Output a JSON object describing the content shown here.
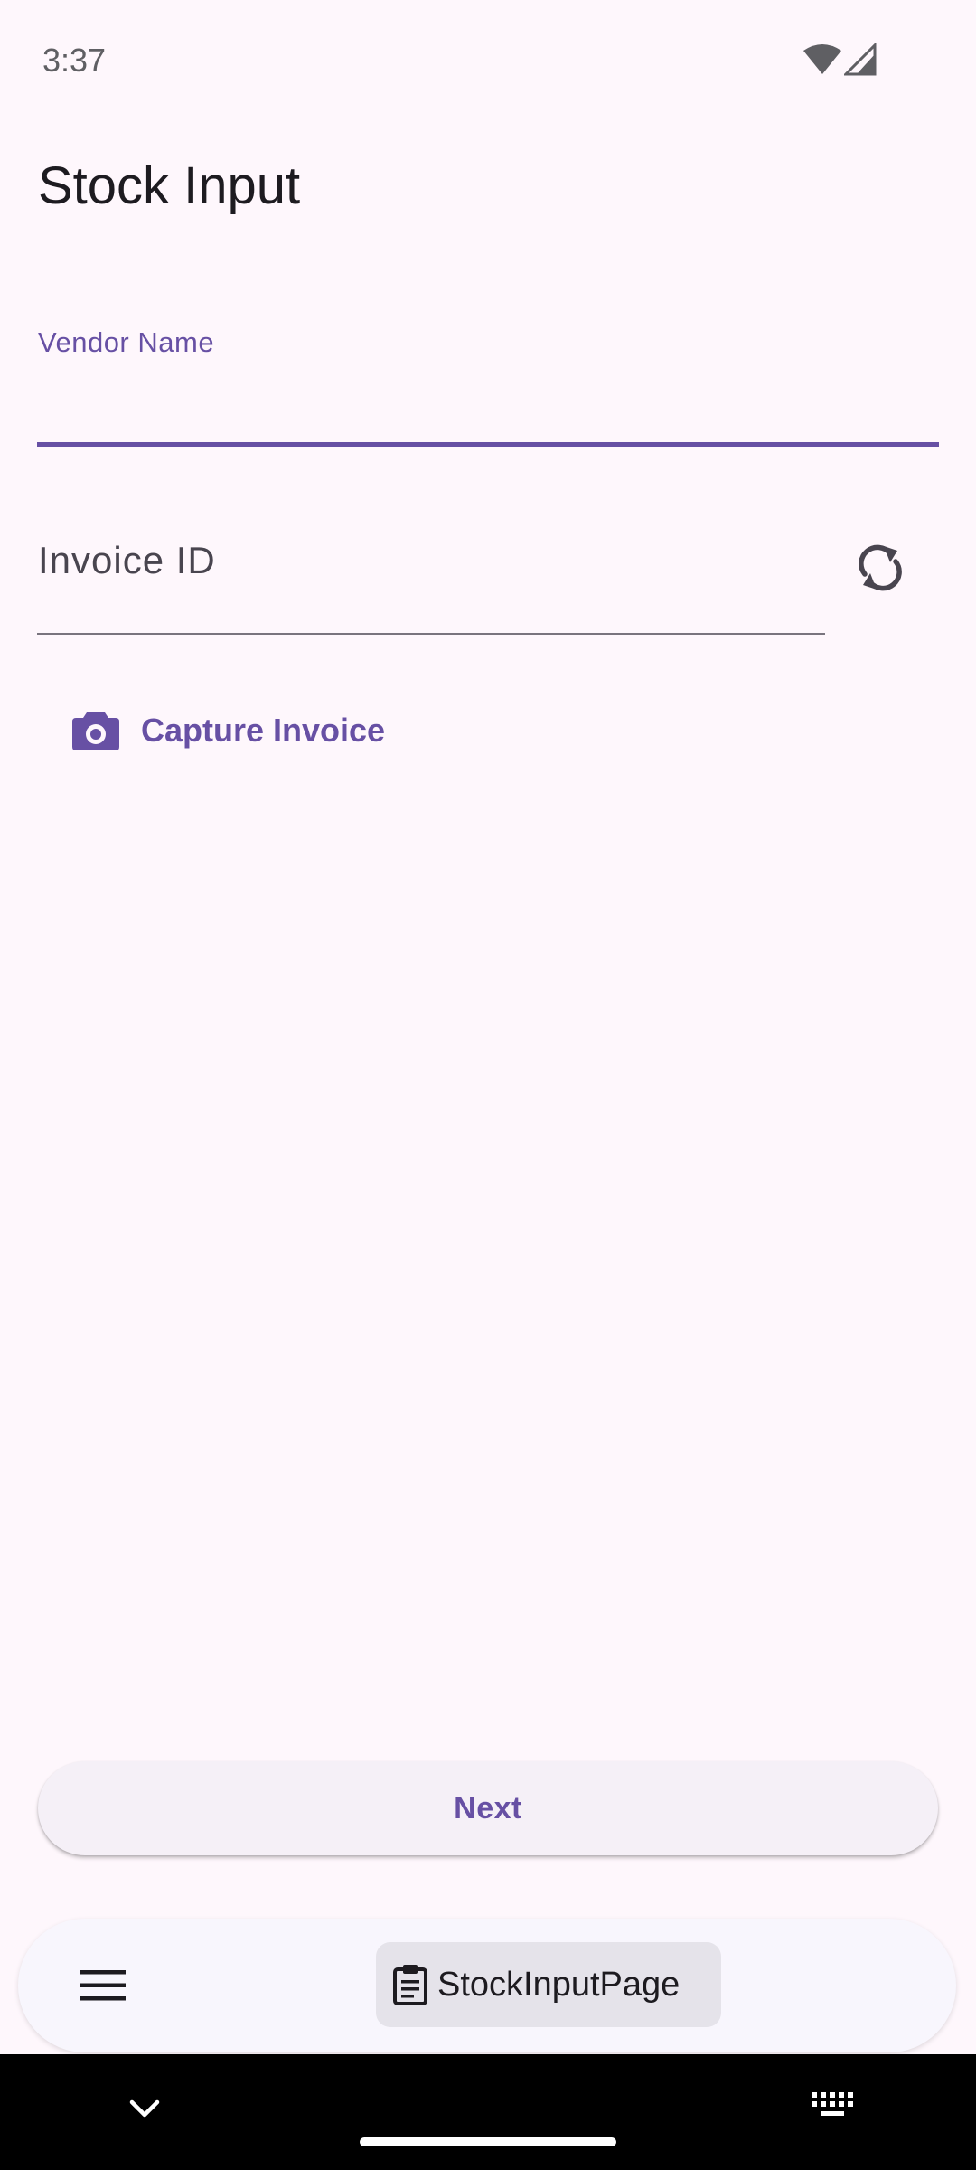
{
  "status_bar": {
    "time": "3:37",
    "icons": [
      "wifi-icon",
      "cell-signal-icon"
    ]
  },
  "page": {
    "title": "Stock Input"
  },
  "form": {
    "vendor_name": {
      "label": "Vendor Name",
      "value": ""
    },
    "invoice_id": {
      "placeholder": "Invoice ID",
      "value": "",
      "action_icon": "refresh-icon"
    },
    "capture_button": {
      "label": "Capture Invoice",
      "icon": "camera-icon"
    }
  },
  "actions": {
    "next_label": "Next"
  },
  "bottom_bar": {
    "menu_icon": "menu-icon",
    "current_page": {
      "label": "StockInputPage",
      "icon": "clipboard-icon"
    }
  },
  "colors": {
    "accent": "#6750A4",
    "background": "#FEF7FC",
    "text": "#1D1B20"
  }
}
